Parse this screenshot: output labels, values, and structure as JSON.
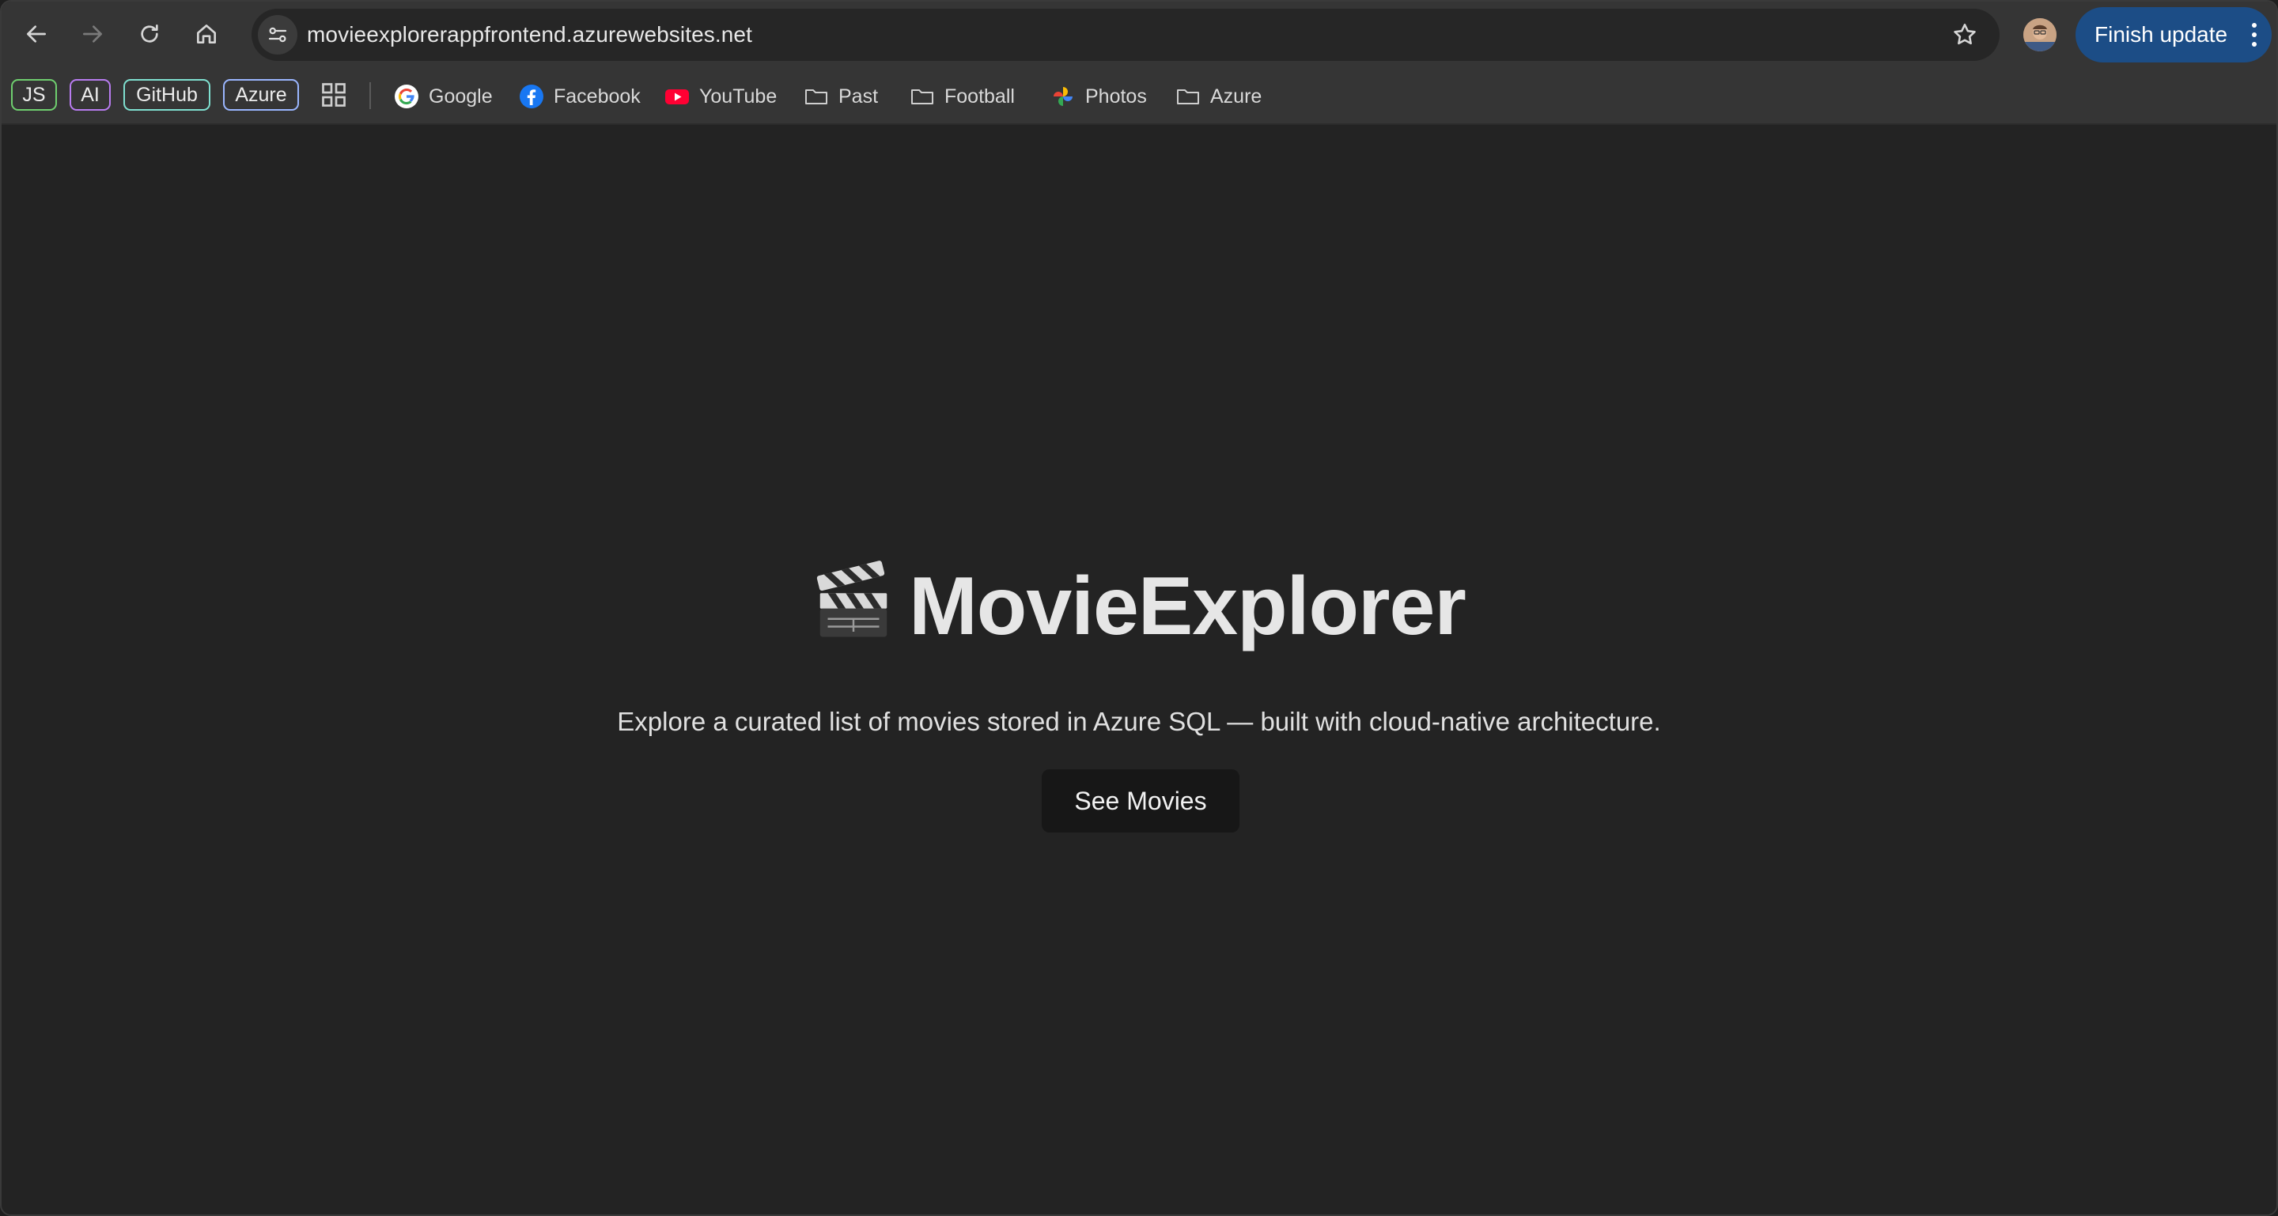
{
  "browser": {
    "url": "movieexplorerappfrontend.azurewebsites.net",
    "finish_update_label": "Finish update",
    "icons": [
      "back-arrow-icon",
      "forward-arrow-icon",
      "reload-icon",
      "home-icon",
      "site-settings-icon",
      "bookmark-star-icon",
      "kebab-menu-icon"
    ]
  },
  "bookmarks": {
    "tags": [
      {
        "label": "JS",
        "color": "#6fcf6f"
      },
      {
        "label": "AI",
        "color": "#b87cf0"
      },
      {
        "label": "GitHub",
        "color": "#7fe0d0"
      },
      {
        "label": "Azure",
        "color": "#9ab6ff"
      }
    ],
    "items": [
      {
        "label": "Google",
        "icon": "google-icon"
      },
      {
        "label": "Facebook",
        "icon": "facebook-icon"
      },
      {
        "label": "YouTube",
        "icon": "youtube-icon"
      },
      {
        "label": "Past",
        "icon": "folder-icon"
      },
      {
        "label": "Football",
        "icon": "folder-icon"
      },
      {
        "label": "Photos",
        "icon": "google-photos-icon"
      },
      {
        "label": "Azure",
        "icon": "folder-icon"
      }
    ]
  },
  "page": {
    "title": "MovieExplorer",
    "title_icon": "clapperboard-icon",
    "tagline": "Explore a curated list of movies stored in Azure SQL — built with cloud-native architecture.",
    "cta_label": "See Movies"
  }
}
